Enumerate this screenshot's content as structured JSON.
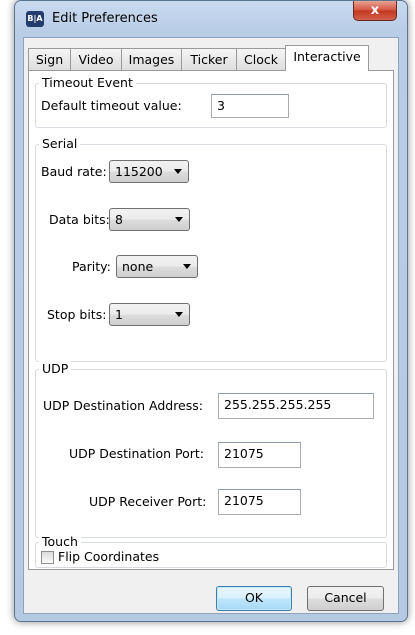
{
  "window": {
    "icon_text": "B|A",
    "title": "Edit Preferences",
    "close_glyph": "x"
  },
  "tabs": [
    {
      "label": "Sign"
    },
    {
      "label": "Video"
    },
    {
      "label": "Images"
    },
    {
      "label": "Ticker"
    },
    {
      "label": "Clock"
    },
    {
      "label": "Interactive",
      "active": true
    }
  ],
  "timeout": {
    "group_title": "Timeout Event",
    "label": "Default timeout value:",
    "value": "3"
  },
  "serial": {
    "group_title": "Serial",
    "baud_label": "Baud rate:",
    "baud_value": "115200",
    "data_bits_label": "Data bits:",
    "data_bits_value": "8",
    "parity_label": "Parity:",
    "parity_value": "none",
    "stop_bits_label": "Stop bits:",
    "stop_bits_value": "1"
  },
  "udp": {
    "group_title": "UDP",
    "dest_address_label": "UDP Destination Address:",
    "dest_address_value": "255.255.255.255",
    "dest_port_label": "UDP Destination Port:",
    "dest_port_value": "21075",
    "receiver_port_label": "UDP Receiver Port:",
    "receiver_port_value": "21075"
  },
  "touch": {
    "group_title": "Touch",
    "flip_label": "Flip Coordinates",
    "flip_checked": false
  },
  "footer": {
    "ok_label": "OK",
    "cancel_label": "Cancel"
  }
}
